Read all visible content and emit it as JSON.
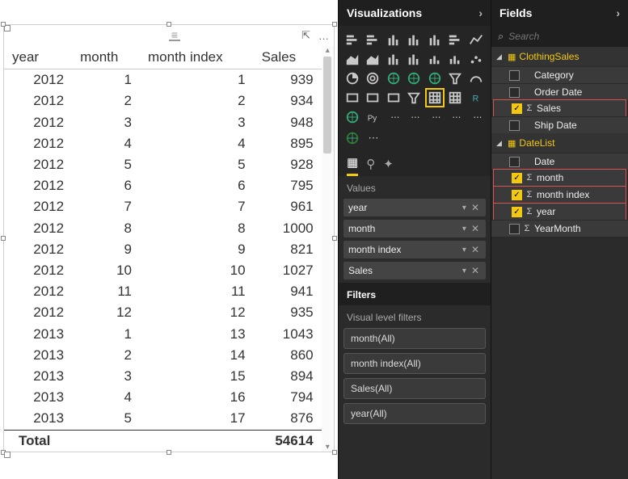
{
  "panels": {
    "visualizations": "Visualizations",
    "fields": "Fields"
  },
  "search": {
    "placeholder": "Search"
  },
  "table": {
    "headers": [
      "year",
      "month",
      "month index",
      "Sales"
    ],
    "rows": [
      [
        "2012",
        "1",
        "1",
        "939"
      ],
      [
        "2012",
        "2",
        "2",
        "934"
      ],
      [
        "2012",
        "3",
        "3",
        "948"
      ],
      [
        "2012",
        "4",
        "4",
        "895"
      ],
      [
        "2012",
        "5",
        "5",
        "928"
      ],
      [
        "2012",
        "6",
        "6",
        "795"
      ],
      [
        "2012",
        "7",
        "7",
        "961"
      ],
      [
        "2012",
        "8",
        "8",
        "1000"
      ],
      [
        "2012",
        "9",
        "9",
        "821"
      ],
      [
        "2012",
        "10",
        "10",
        "1027"
      ],
      [
        "2012",
        "11",
        "11",
        "941"
      ],
      [
        "2012",
        "12",
        "12",
        "935"
      ],
      [
        "2013",
        "1",
        "13",
        "1043"
      ],
      [
        "2013",
        "2",
        "14",
        "860"
      ],
      [
        "2013",
        "3",
        "15",
        "894"
      ],
      [
        "2013",
        "4",
        "16",
        "794"
      ],
      [
        "2013",
        "5",
        "17",
        "876"
      ]
    ],
    "total_label": "Total",
    "total_value": "54614"
  },
  "values_section_label": "Values",
  "value_wells": [
    "year",
    "month",
    "month index",
    "Sales"
  ],
  "filters_label": "Filters",
  "visual_filters_label": "Visual level filters",
  "filter_pills": [
    "month(All)",
    "month index(All)",
    "Sales(All)",
    "year(All)"
  ],
  "field_tables": [
    {
      "name": "ClothingSales",
      "fields": [
        {
          "label": "Category",
          "checked": false,
          "sigma": false,
          "highlight": false
        },
        {
          "label": "Order Date",
          "checked": false,
          "sigma": false,
          "highlight": false
        },
        {
          "label": "Sales",
          "checked": true,
          "sigma": true,
          "highlight": true
        },
        {
          "label": "Ship Date",
          "checked": false,
          "sigma": false,
          "highlight": false
        }
      ]
    },
    {
      "name": "DateList",
      "fields": [
        {
          "label": "Date",
          "checked": false,
          "sigma": false,
          "highlight": false
        },
        {
          "label": "month",
          "checked": true,
          "sigma": true,
          "highlight": true
        },
        {
          "label": "month index",
          "checked": true,
          "sigma": true,
          "highlight": true
        },
        {
          "label": "year",
          "checked": true,
          "sigma": true,
          "highlight": true
        },
        {
          "label": "YearMonth",
          "checked": false,
          "sigma": true,
          "highlight": false
        }
      ]
    }
  ],
  "ellipsis": "…",
  "viz_icons": [
    "bar-stacked",
    "bar-clustered",
    "column-stacked",
    "column-clustered",
    "column-100",
    "bar-100",
    "line",
    "area",
    "area-stacked",
    "line-column",
    "line-column-stacked",
    "ribbon",
    "waterfall",
    "scatter",
    "pie",
    "donut",
    "treemap",
    "map",
    "filled-map",
    "funnel",
    "gauge",
    "card",
    "multi-card",
    "kpi",
    "slicer",
    "table",
    "matrix",
    "r-visual",
    "arcgis",
    "python",
    "key-influencers",
    "qa",
    "paginated",
    "decomposition",
    "custom-visual"
  ],
  "selected_viz_index": 25
}
